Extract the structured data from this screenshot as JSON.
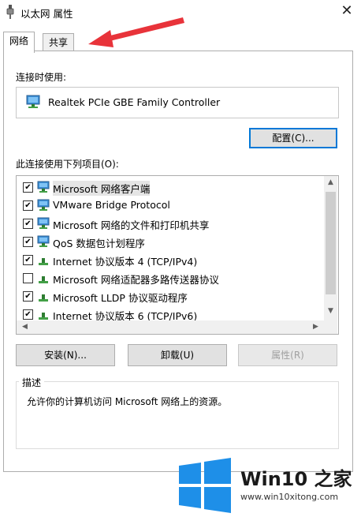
{
  "window": {
    "title": "以太网 属性",
    "close_label": "✕"
  },
  "tabs": [
    {
      "label": "网络",
      "active": true
    },
    {
      "label": "共享",
      "active": false
    }
  ],
  "connect_using": {
    "label": "连接时使用:",
    "adapter": "Realtek PCIe GBE Family Controller",
    "configure_button": "配置(C)..."
  },
  "items_section": {
    "label": "此连接使用下列项目(O):",
    "items": [
      {
        "label": "Microsoft 网络客户端",
        "checked": true,
        "icon": "network-client-icon"
      },
      {
        "label": "VMware Bridge Protocol",
        "checked": true,
        "icon": "network-service-icon"
      },
      {
        "label": "Microsoft 网络的文件和打印机共享",
        "checked": true,
        "icon": "network-service-icon"
      },
      {
        "label": "QoS 数据包计划程序",
        "checked": true,
        "icon": "network-service-icon"
      },
      {
        "label": "Internet 协议版本 4 (TCP/IPv4)",
        "checked": true,
        "icon": "protocol-icon"
      },
      {
        "label": "Microsoft 网络适配器多路传送器协议",
        "checked": false,
        "icon": "protocol-icon"
      },
      {
        "label": "Microsoft LLDP 协议驱动程序",
        "checked": true,
        "icon": "protocol-icon"
      },
      {
        "label": "Internet 协议版本 6 (TCP/IPv6)",
        "checked": true,
        "icon": "protocol-icon"
      }
    ]
  },
  "buttons": {
    "install": "安装(N)...",
    "uninstall": "卸载(U)",
    "properties": "属性(R)"
  },
  "description": {
    "legend": "描述",
    "text": "允许你的计算机访问 Microsoft 网络上的资源。"
  },
  "watermark": {
    "title": "Win10 之家",
    "url": "www.win10xitong.com"
  },
  "colors": {
    "accent": "#0078d7",
    "annotation_arrow": "#e8333a",
    "logo_blue": "#1e8fe8"
  }
}
